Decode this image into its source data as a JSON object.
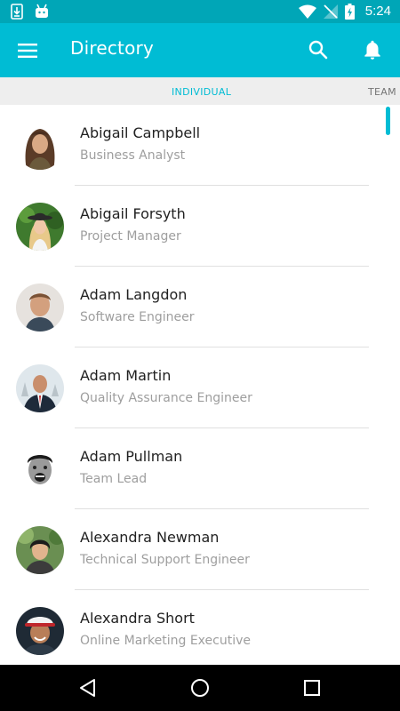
{
  "status_bar": {
    "time": "5:24",
    "icons": [
      "download-icon",
      "android-icon",
      "wifi-icon",
      "no-signal-icon",
      "battery-charging-icon"
    ]
  },
  "app_bar": {
    "title": "Directory",
    "icons": [
      "menu-icon",
      "search-icon",
      "notifications-bell-icon"
    ]
  },
  "tabs": {
    "individual": "INDIVIDUAL",
    "team": "TEAM",
    "active": "individual"
  },
  "colors": {
    "primary": "#00bcd4",
    "primary_dark": "#00a6b7",
    "tab_bar": "#eeeeee",
    "name_text": "#212121",
    "subtitle_text": "#9e9e9e"
  },
  "contacts": [
    {
      "name": "Abigail Campbell",
      "title": "Business Analyst"
    },
    {
      "name": "Abigail Forsyth",
      "title": "Project Manager"
    },
    {
      "name": "Adam Langdon",
      "title": "Software Engineer"
    },
    {
      "name": "Adam Martin",
      "title": "Quality Assurance Engineer"
    },
    {
      "name": "Adam Pullman",
      "title": "Team Lead"
    },
    {
      "name": "Alexandra Newman",
      "title": "Technical Support Engineer"
    },
    {
      "name": "Alexandra Short",
      "title": "Online Marketing Executive"
    }
  ],
  "nav_bar": {
    "icons": [
      "back-icon",
      "home-icon",
      "recents-icon"
    ]
  }
}
